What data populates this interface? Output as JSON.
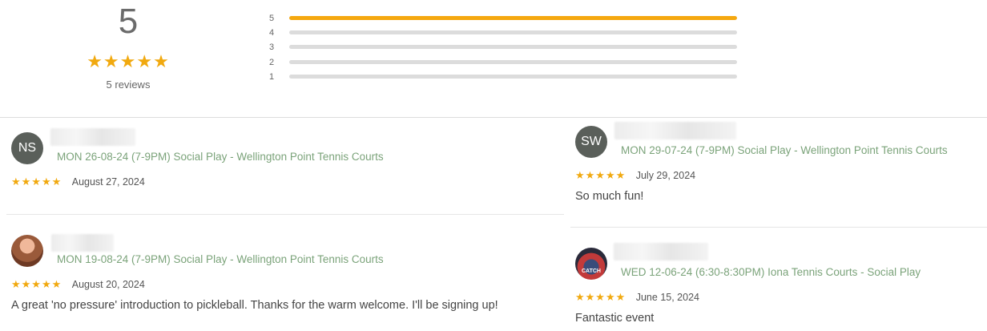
{
  "summary": {
    "average": "5",
    "stars": "★★★★★",
    "count_text": "5 reviews"
  },
  "distribution": [
    {
      "label": "5",
      "fraction": 1.0
    },
    {
      "label": "4",
      "fraction": 0.0
    },
    {
      "label": "3",
      "fraction": 0.0
    },
    {
      "label": "2",
      "fraction": 0.0
    },
    {
      "label": "1",
      "fraction": 0.0
    }
  ],
  "reviews": [
    {
      "avatar_initials": "NS",
      "event": "MON 26-08-24 (7-9PM) Social Play - Wellington Point Tennis Courts",
      "stars": "★★★★★",
      "rating": 5,
      "date": "August 27, 2024",
      "comment": ""
    },
    {
      "avatar_initials": "",
      "event": "MON 19-08-24 (7-9PM) Social Play - Wellington Point Tennis Courts",
      "stars": "★★★★★",
      "rating": 5,
      "date": "August 20, 2024",
      "comment": "A great 'no pressure' introduction to pickleball. Thanks for the warm welcome. I'll be signing up!"
    },
    {
      "avatar_initials": "SW",
      "event": "MON 29-07-24 (7-9PM) Social Play - Wellington Point Tennis Courts",
      "stars": "★★★★★",
      "rating": 5,
      "date": "July 29, 2024",
      "comment": "So much fun!"
    },
    {
      "avatar_initials": "",
      "avatar_caption": "CATCH",
      "event": "WED 12-06-24 (6:30-8:30PM) Iona Tennis Courts - Social Play",
      "stars": "★★★★★",
      "rating": 5,
      "date": "June 15, 2024",
      "comment": "Fantastic event"
    }
  ],
  "colors": {
    "accent_star": "#f1a90f",
    "bar_fill": "#f5a80f",
    "bar_track": "#dcdcdc",
    "event_link": "#7ba37a"
  }
}
